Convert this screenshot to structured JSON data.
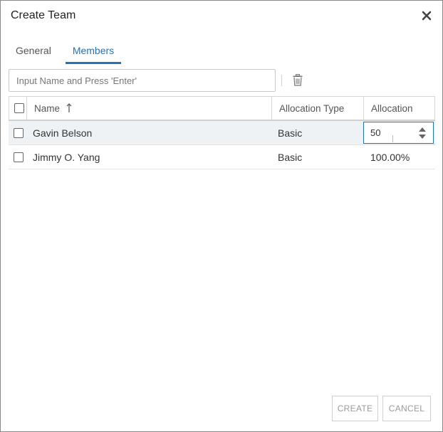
{
  "dialog": {
    "title": "Create Team"
  },
  "tabs": [
    {
      "label": "General",
      "active": false
    },
    {
      "label": "Members",
      "active": true
    }
  ],
  "search": {
    "placeholder": "Input Name and Press 'Enter'",
    "value": ""
  },
  "table": {
    "columns": [
      "Name",
      "Allocation Type",
      "Allocation"
    ],
    "sort": {
      "column": "Name",
      "direction": "ascending",
      "icon": "arrow-up-icon"
    },
    "rows": [
      {
        "name": "Gavin Belson",
        "allocation_type": "Basic",
        "allocation": "50",
        "editing": true
      },
      {
        "name": "Jimmy O. Yang",
        "allocation_type": "Basic",
        "allocation": "100.00%",
        "editing": false
      }
    ]
  },
  "buttons": {
    "create": "CREATE",
    "cancel": "CANCEL"
  },
  "colors": {
    "accent": "#1f73b8",
    "selected_row": "#eef2f5",
    "border": "#d6d6d6",
    "disabled_text": "#9a9a9a"
  }
}
